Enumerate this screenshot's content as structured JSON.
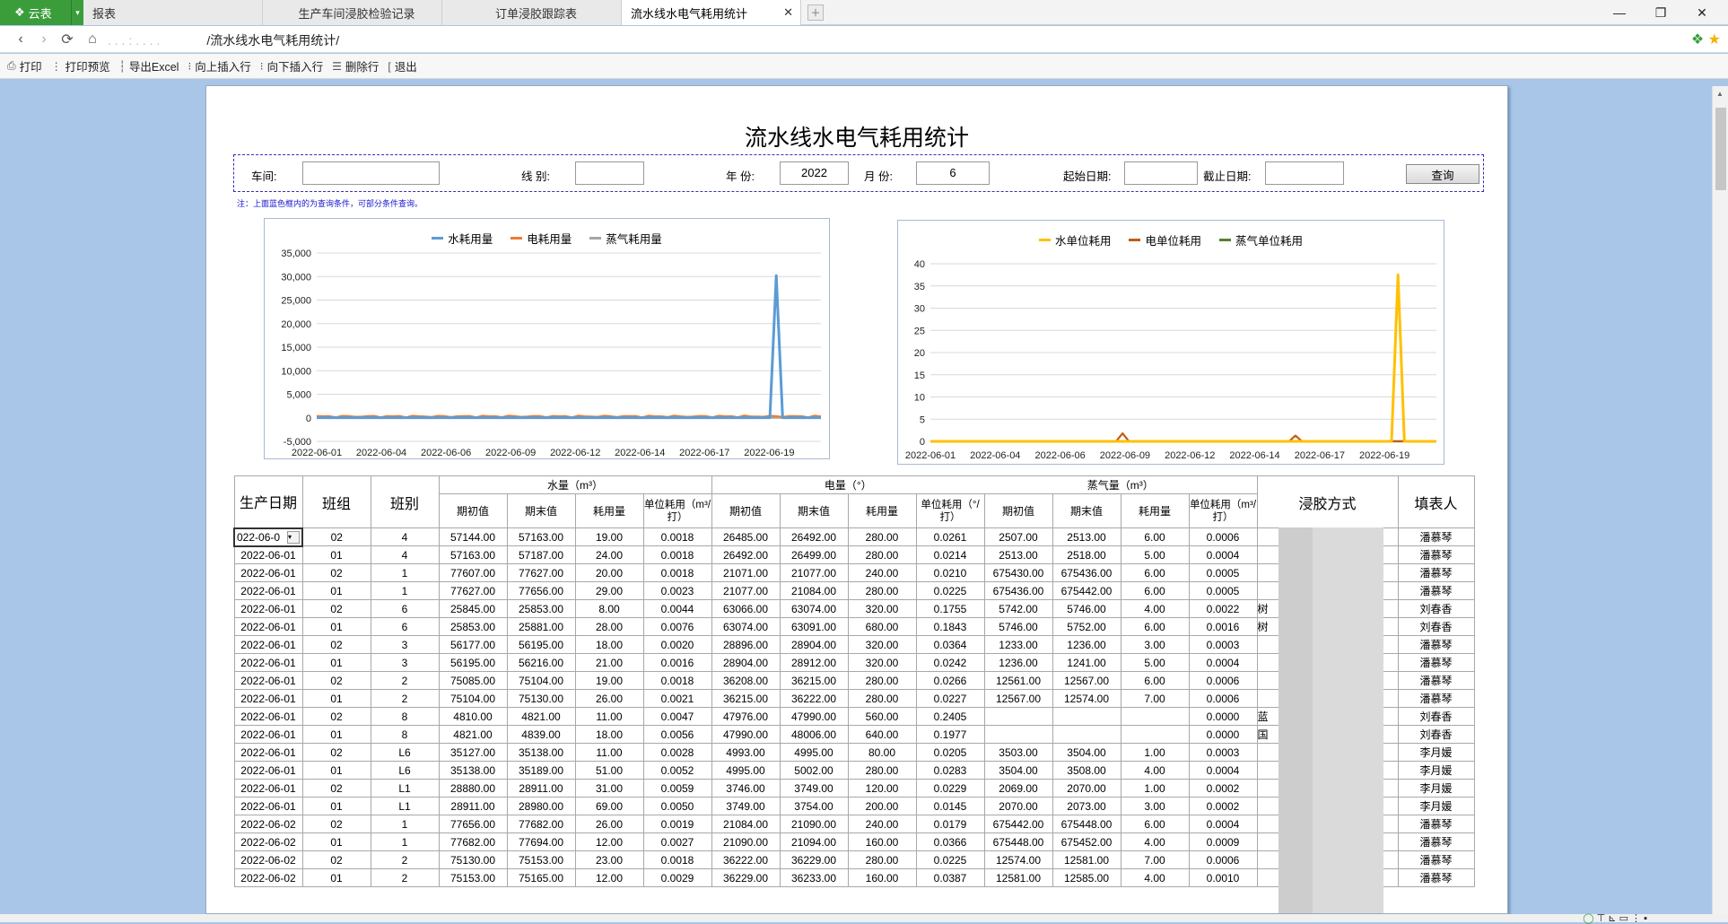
{
  "app": {
    "brand": "云表",
    "brand_caret": "▾"
  },
  "tabs": [
    {
      "label": "报表",
      "active": false
    },
    {
      "label": "生产车间浸胶检验记录",
      "active": false
    },
    {
      "label": "订单浸胶跟踪表",
      "active": false
    },
    {
      "label": "流水线水电气耗用统计",
      "active": true
    }
  ],
  "address": {
    "blurred_prefix": ". . . : . . . .",
    "path": "/流水线水电气耗用统计/"
  },
  "toolbar": [
    {
      "icon": "print-icon",
      "label": "打印"
    },
    {
      "icon": "print-preview-icon",
      "label": "打印预览"
    },
    {
      "icon": "export-excel-icon",
      "label": "导出Excel"
    },
    {
      "icon": "insert-above-icon",
      "label": "向上插入行"
    },
    {
      "icon": "insert-below-icon",
      "label": "向下插入行"
    },
    {
      "icon": "delete-row-icon",
      "label": "删除行"
    },
    {
      "icon": "exit-icon",
      "label": "退出"
    }
  ],
  "title": "流水线水电气耗用统计",
  "filters": {
    "workshop_label": "车间:",
    "workshop_value": "",
    "line_label": "线 别:",
    "line_value": "",
    "year_label": "年 份:",
    "year_value": "2022",
    "month_label": "月 份:",
    "month_value": "6",
    "start_label": "起始日期:",
    "start_value": "",
    "end_label": "截止日期:",
    "end_value": "",
    "query_label": "查询"
  },
  "note": "注：上面蓝色框内的为查询条件，可部分条件查询。",
  "chart_data": [
    {
      "type": "line",
      "x_ticks": [
        "2022-06-01",
        "2022-06-04",
        "2022-06-06",
        "2022-06-09",
        "2022-06-12",
        "2022-06-14",
        "2022-06-17",
        "2022-06-19"
      ],
      "ylim": [
        -5000,
        35000
      ],
      "y_ticks": [
        "-5,000",
        "0",
        "5,000",
        "10,000",
        "15,000",
        "20,000",
        "25,000",
        "30,000",
        "35,000"
      ],
      "grid": true,
      "legend": "top",
      "series": [
        {
          "name": "水耗用量",
          "color": "#5b9bd5",
          "baseline": 20,
          "spike_index": 72,
          "spike_value": 30200
        },
        {
          "name": "电耗用量",
          "color": "#ed7d31",
          "baseline": 300,
          "noise": 250
        },
        {
          "name": "蒸气耗用量",
          "color": "#a5a5a5",
          "baseline": 5
        }
      ],
      "n_points": 80
    },
    {
      "type": "line",
      "x_ticks": [
        "2022-06-01",
        "2022-06-04",
        "2022-06-06",
        "2022-06-09",
        "2022-06-12",
        "2022-06-14",
        "2022-06-17",
        "2022-06-19"
      ],
      "ylim": [
        0,
        40
      ],
      "y_ticks": [
        "0",
        "5",
        "10",
        "15",
        "20",
        "25",
        "30",
        "35",
        "40"
      ],
      "grid": true,
      "legend": "top",
      "series": [
        {
          "name": "水单位耗用",
          "color": "#ffc000",
          "baseline": 0.003,
          "spike_index": 73,
          "spike_value": 37.5
        },
        {
          "name": "电单位耗用",
          "color": "#c55a11",
          "baseline": 0.03,
          "extra_spikes": [
            [
              30,
              1.8
            ],
            [
              57,
              1.3
            ]
          ]
        },
        {
          "name": "蒸气单位耗用",
          "color": "#548235",
          "baseline": 0.0005
        }
      ],
      "n_points": 80
    }
  ],
  "table": {
    "headers": {
      "date": "生产日期",
      "group": "班组",
      "shift": "班别",
      "water": "水量（m³）",
      "power": "电量（°）",
      "steam": "蒸气量（m³）",
      "method": "浸胶方式",
      "filler": "填表人",
      "begin": "期初值",
      "end": "期末值",
      "used": "耗用量",
      "unit_water": "单位耗用（m³/打）",
      "unit_power": "单位耗用（°/打）",
      "unit_steam": "单位耗用（m³/打）"
    },
    "rows": [
      [
        "022-06-0",
        "02",
        "4",
        "57144.00",
        "57163.00",
        "19.00",
        "0.0018",
        "26485.00",
        "26492.00",
        "280.00",
        "0.0261",
        "2507.00",
        "2513.00",
        "6.00",
        "0.0006",
        "",
        "潘慕琴"
      ],
      [
        "2022-06-01",
        "01",
        "4",
        "57163.00",
        "57187.00",
        "24.00",
        "0.0018",
        "26492.00",
        "26499.00",
        "280.00",
        "0.0214",
        "2513.00",
        "2518.00",
        "5.00",
        "0.0004",
        "",
        "潘慕琴"
      ],
      [
        "2022-06-01",
        "02",
        "1",
        "77607.00",
        "77627.00",
        "20.00",
        "0.0018",
        "21071.00",
        "21077.00",
        "240.00",
        "0.0210",
        "675430.00",
        "675436.00",
        "6.00",
        "0.0005",
        "",
        "潘慕琴"
      ],
      [
        "2022-06-01",
        "01",
        "1",
        "77627.00",
        "77656.00",
        "29.00",
        "0.0023",
        "21077.00",
        "21084.00",
        "280.00",
        "0.0225",
        "675436.00",
        "675442.00",
        "6.00",
        "0.0005",
        "",
        "潘慕琴"
      ],
      [
        "2022-06-01",
        "02",
        "6",
        "25845.00",
        "25853.00",
        "8.00",
        "0.0044",
        "63066.00",
        "63074.00",
        "320.00",
        "0.1755",
        "5742.00",
        "5746.00",
        "4.00",
        "0.0022",
        "树",
        "刘春香"
      ],
      [
        "2022-06-01",
        "01",
        "6",
        "25853.00",
        "25881.00",
        "28.00",
        "0.0076",
        "63074.00",
        "63091.00",
        "680.00",
        "0.1843",
        "5746.00",
        "5752.00",
        "6.00",
        "0.0016",
        "树",
        "刘春香"
      ],
      [
        "2022-06-01",
        "02",
        "3",
        "56177.00",
        "56195.00",
        "18.00",
        "0.0020",
        "28896.00",
        "28904.00",
        "320.00",
        "0.0364",
        "1233.00",
        "1236.00",
        "3.00",
        "0.0003",
        "",
        "潘慕琴"
      ],
      [
        "2022-06-01",
        "01",
        "3",
        "56195.00",
        "56216.00",
        "21.00",
        "0.0016",
        "28904.00",
        "28912.00",
        "320.00",
        "0.0242",
        "1236.00",
        "1241.00",
        "5.00",
        "0.0004",
        "",
        "潘慕琴"
      ],
      [
        "2022-06-01",
        "02",
        "2",
        "75085.00",
        "75104.00",
        "19.00",
        "0.0018",
        "36208.00",
        "36215.00",
        "280.00",
        "0.0266",
        "12561.00",
        "12567.00",
        "6.00",
        "0.0006",
        "",
        "潘慕琴"
      ],
      [
        "2022-06-01",
        "01",
        "2",
        "75104.00",
        "75130.00",
        "26.00",
        "0.0021",
        "36215.00",
        "36222.00",
        "280.00",
        "0.0227",
        "12567.00",
        "12574.00",
        "7.00",
        "0.0006",
        "",
        "潘慕琴"
      ],
      [
        "2022-06-01",
        "02",
        "8",
        "4810.00",
        "4821.00",
        "11.00",
        "0.0047",
        "47976.00",
        "47990.00",
        "560.00",
        "0.2405",
        "",
        "",
        "",
        "0.0000",
        "蓝",
        "刘春香"
      ],
      [
        "2022-06-01",
        "01",
        "8",
        "4821.00",
        "4839.00",
        "18.00",
        "0.0056",
        "47990.00",
        "48006.00",
        "640.00",
        "0.1977",
        "",
        "",
        "",
        "0.0000",
        "国",
        "刘春香"
      ],
      [
        "2022-06-01",
        "02",
        "L6",
        "35127.00",
        "35138.00",
        "11.00",
        "0.0028",
        "4993.00",
        "4995.00",
        "80.00",
        "0.0205",
        "3503.00",
        "3504.00",
        "1.00",
        "0.0003",
        "",
        "李月媛"
      ],
      [
        "2022-06-01",
        "01",
        "L6",
        "35138.00",
        "35189.00",
        "51.00",
        "0.0052",
        "4995.00",
        "5002.00",
        "280.00",
        "0.0283",
        "3504.00",
        "3508.00",
        "4.00",
        "0.0004",
        "",
        "李月媛"
      ],
      [
        "2022-06-01",
        "02",
        "L1",
        "28880.00",
        "28911.00",
        "31.00",
        "0.0059",
        "3746.00",
        "3749.00",
        "120.00",
        "0.0229",
        "2069.00",
        "2070.00",
        "1.00",
        "0.0002",
        "",
        "李月媛"
      ],
      [
        "2022-06-01",
        "01",
        "L1",
        "28911.00",
        "28980.00",
        "69.00",
        "0.0050",
        "3749.00",
        "3754.00",
        "200.00",
        "0.0145",
        "2070.00",
        "2073.00",
        "3.00",
        "0.0002",
        "",
        "李月媛"
      ],
      [
        "2022-06-02",
        "02",
        "1",
        "77656.00",
        "77682.00",
        "26.00",
        "0.0019",
        "21084.00",
        "21090.00",
        "240.00",
        "0.0179",
        "675442.00",
        "675448.00",
        "6.00",
        "0.0004",
        "",
        "潘慕琴"
      ],
      [
        "2022-06-02",
        "01",
        "1",
        "77682.00",
        "77694.00",
        "12.00",
        "0.0027",
        "21090.00",
        "21094.00",
        "160.00",
        "0.0366",
        "675448.00",
        "675452.00",
        "4.00",
        "0.0009",
        "",
        "潘慕琴"
      ],
      [
        "2022-06-02",
        "02",
        "2",
        "75130.00",
        "75153.00",
        "23.00",
        "0.0018",
        "36222.00",
        "36229.00",
        "280.00",
        "0.0225",
        "12574.00",
        "12581.00",
        "7.00",
        "0.0006",
        "",
        "潘慕琴"
      ],
      [
        "2022-06-02",
        "01",
        "2",
        "75153.00",
        "75165.00",
        "12.00",
        "0.0029",
        "36229.00",
        "36233.00",
        "160.00",
        "0.0387",
        "12581.00",
        "12585.00",
        "4.00",
        "0.0010",
        "",
        "潘慕琴"
      ]
    ]
  }
}
